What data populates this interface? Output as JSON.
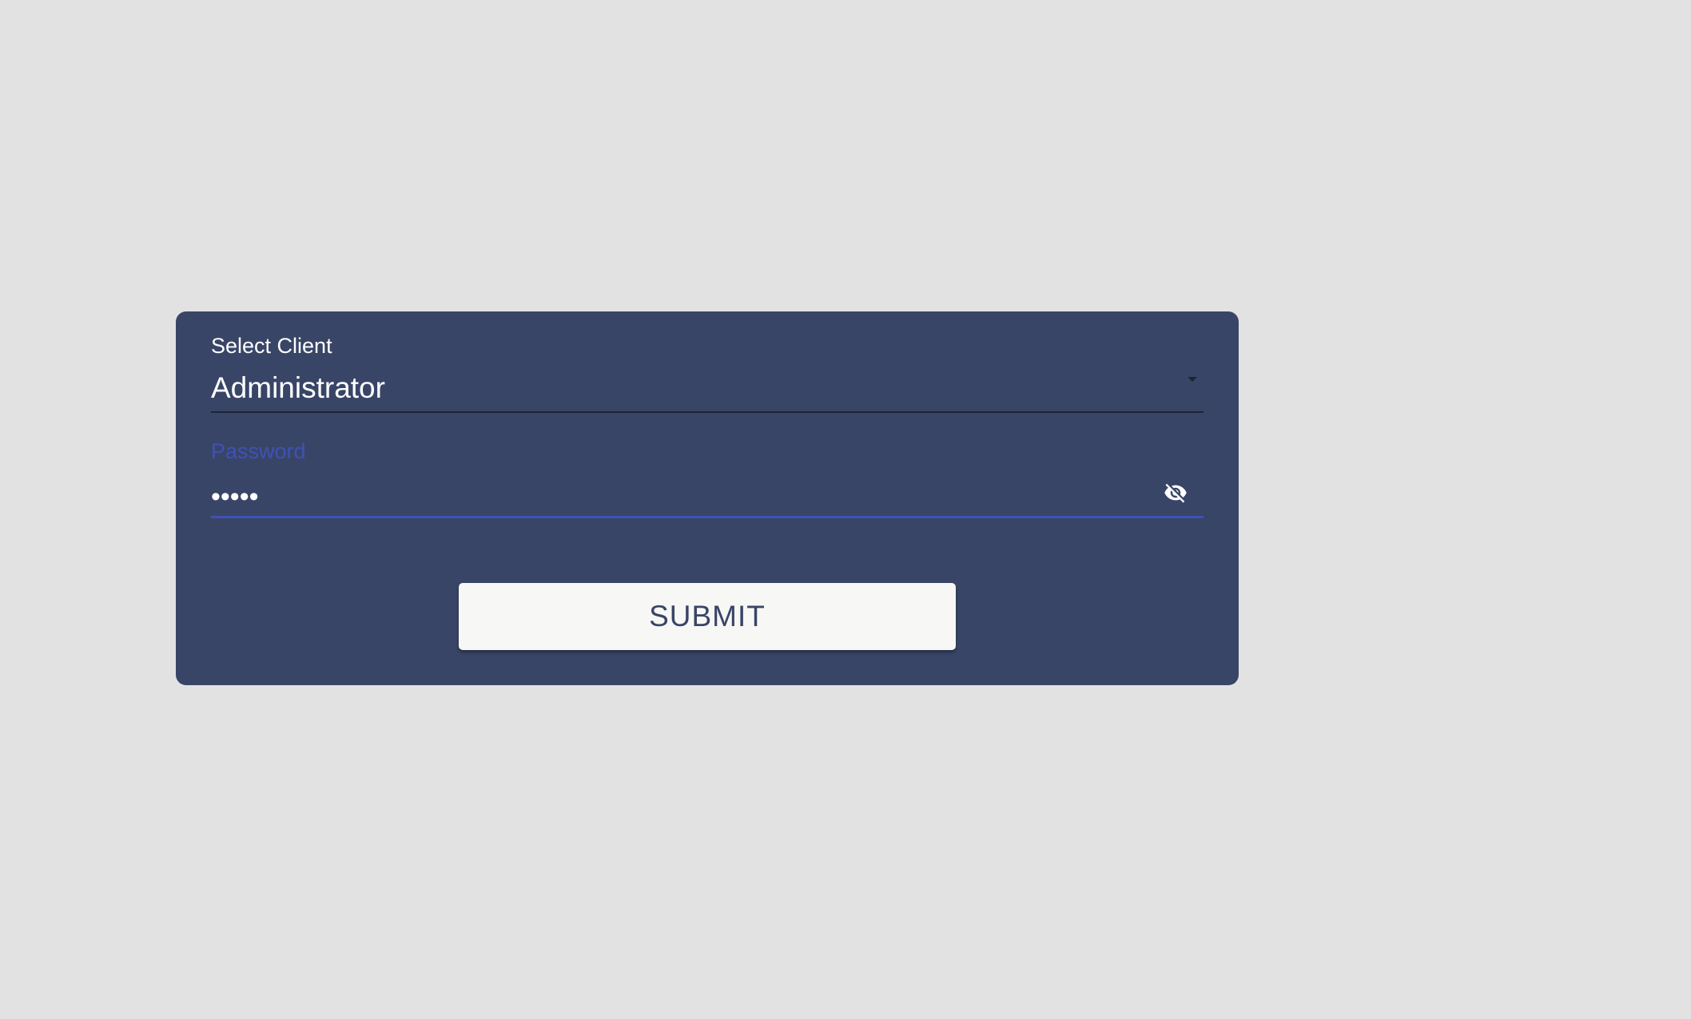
{
  "login_form": {
    "client_select": {
      "label": "Select Client",
      "value": "Administrator"
    },
    "password": {
      "label": "Password",
      "masked_value": "•••••",
      "visibility_icon": "visibility-off-icon"
    },
    "submit_label": "SUBMIT"
  },
  "colors": {
    "page_background": "#e2e2e2",
    "card_background": "#394567",
    "accent": "#3f51b5",
    "button_background": "#f7f7f5",
    "button_text": "#394567"
  }
}
